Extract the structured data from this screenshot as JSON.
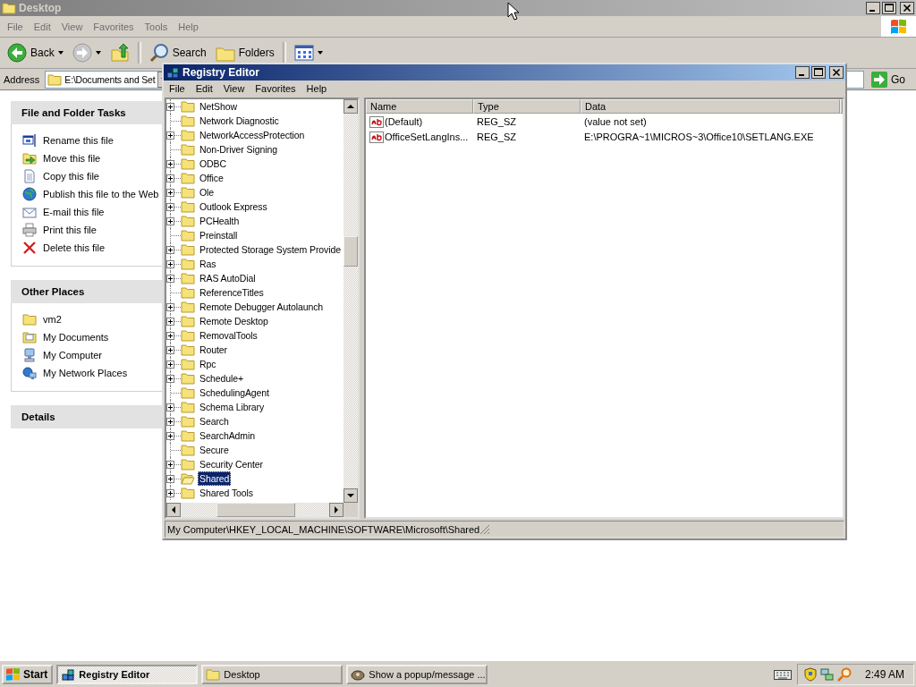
{
  "explorer": {
    "title": "Desktop",
    "menu": [
      "File",
      "Edit",
      "View",
      "Favorites",
      "Tools",
      "Help"
    ],
    "toolbar": {
      "back": "Back",
      "search": "Search",
      "folders": "Folders"
    },
    "address": {
      "label": "Address",
      "value": "E:\\Documents and Set",
      "go": "Go"
    },
    "task_panels": [
      {
        "title": "File and Folder Tasks",
        "items": [
          "Rename this file",
          "Move this file",
          "Copy this file",
          "Publish this file to the Web",
          "E-mail this file",
          "Print this file",
          "Delete this file"
        ]
      },
      {
        "title": "Other Places",
        "items": [
          "vm2",
          "My Documents",
          "My Computer",
          "My Network Places"
        ]
      },
      {
        "title": "Details"
      }
    ]
  },
  "registry_editor": {
    "title": "Registry Editor",
    "menu": [
      "File",
      "Edit",
      "View",
      "Favorites",
      "Help"
    ],
    "tree": [
      {
        "label": "NetShow",
        "expandable": true,
        "selected": false
      },
      {
        "label": "Network Diagnostic",
        "expandable": false,
        "selected": false
      },
      {
        "label": "NetworkAccessProtection",
        "expandable": true,
        "selected": false
      },
      {
        "label": "Non-Driver Signing",
        "expandable": false,
        "selected": false
      },
      {
        "label": "ODBC",
        "expandable": true,
        "selected": false
      },
      {
        "label": "Office",
        "expandable": true,
        "selected": false
      },
      {
        "label": "Ole",
        "expandable": true,
        "selected": false
      },
      {
        "label": "Outlook Express",
        "expandable": true,
        "selected": false
      },
      {
        "label": "PCHealth",
        "expandable": true,
        "selected": false
      },
      {
        "label": "Preinstall",
        "expandable": false,
        "selected": false
      },
      {
        "label": "Protected Storage System Provide",
        "expandable": true,
        "selected": false
      },
      {
        "label": "Ras",
        "expandable": true,
        "selected": false
      },
      {
        "label": "RAS AutoDial",
        "expandable": true,
        "selected": false
      },
      {
        "label": "ReferenceTitles",
        "expandable": false,
        "selected": false
      },
      {
        "label": "Remote Debugger Autolaunch",
        "expandable": true,
        "selected": false
      },
      {
        "label": "Remote Desktop",
        "expandable": true,
        "selected": false
      },
      {
        "label": "RemovalTools",
        "expandable": true,
        "selected": false
      },
      {
        "label": "Router",
        "expandable": true,
        "selected": false
      },
      {
        "label": "Rpc",
        "expandable": true,
        "selected": false
      },
      {
        "label": "Schedule+",
        "expandable": true,
        "selected": false
      },
      {
        "label": "SchedulingAgent",
        "expandable": false,
        "selected": false
      },
      {
        "label": "Schema Library",
        "expandable": true,
        "selected": false
      },
      {
        "label": "Search",
        "expandable": true,
        "selected": false
      },
      {
        "label": "SearchAdmin",
        "expandable": true,
        "selected": false
      },
      {
        "label": "Secure",
        "expandable": false,
        "selected": false
      },
      {
        "label": "Security Center",
        "expandable": true,
        "selected": false
      },
      {
        "label": "Shared",
        "expandable": true,
        "selected": true
      },
      {
        "label": "Shared Tools",
        "expandable": true,
        "selected": false
      }
    ],
    "columns": [
      "Name",
      "Type",
      "Data"
    ],
    "values": [
      {
        "name": "(Default)",
        "type": "REG_SZ",
        "data": "(value not set)"
      },
      {
        "name": "OfficeSetLangIns...",
        "type": "REG_SZ",
        "data": "E:\\PROGRA~1\\MICROS~3\\Office10\\SETLANG.EXE"
      }
    ],
    "status_bar": "My Computer\\HKEY_LOCAL_MACHINE\\SOFTWARE\\Microsoft\\Shared"
  },
  "taskbar": {
    "start": "Start",
    "tasks": [
      {
        "label": "Registry Editor",
        "selected": true
      },
      {
        "label": "Desktop",
        "selected": false
      },
      {
        "label": "Show a popup/message ...",
        "selected": false
      }
    ],
    "clock": "2:49 AM"
  }
}
